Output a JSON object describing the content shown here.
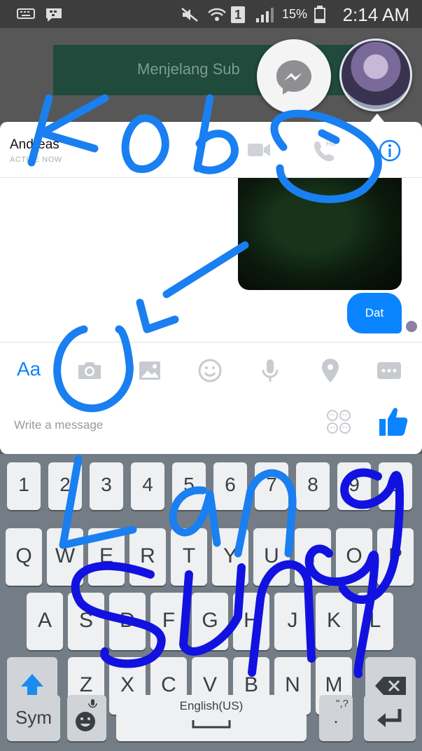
{
  "status_bar": {
    "battery_percent": "15%",
    "time": "2:14 AM",
    "sim_slot": "1"
  },
  "background_app": {
    "banner_text": "Menjelang Sub"
  },
  "chat": {
    "contact_name": "Andreas",
    "contact_status": "ACTIVE NOW",
    "hd_label": "HD",
    "outgoing_message": "Dat"
  },
  "composer": {
    "aa_label": "Aa",
    "placeholder": "Write a message"
  },
  "keyboard": {
    "number_row": [
      "1",
      "2",
      "3",
      "4",
      "5",
      "6",
      "7",
      "8",
      "9",
      "0"
    ],
    "row1": [
      "Q",
      "W",
      "E",
      "R",
      "T",
      "Y",
      "U",
      "I",
      "O",
      "P"
    ],
    "row2": [
      "A",
      "S",
      "D",
      "F",
      "G",
      "H",
      "J",
      "K",
      "L"
    ],
    "row3": [
      "Z",
      "X",
      "C",
      "V",
      "B",
      "N",
      "M"
    ],
    "sym_label": "Sym",
    "space_label": "English(US)",
    "punct_label": "\",?",
    "punct_dot": "."
  },
  "colors": {
    "accent": "#0a84ff",
    "scribble_light": "#1a7ff0",
    "scribble_dark": "#1212e0"
  },
  "handwriting": [
    "Kobo",
    "Lang",
    "Sung"
  ]
}
